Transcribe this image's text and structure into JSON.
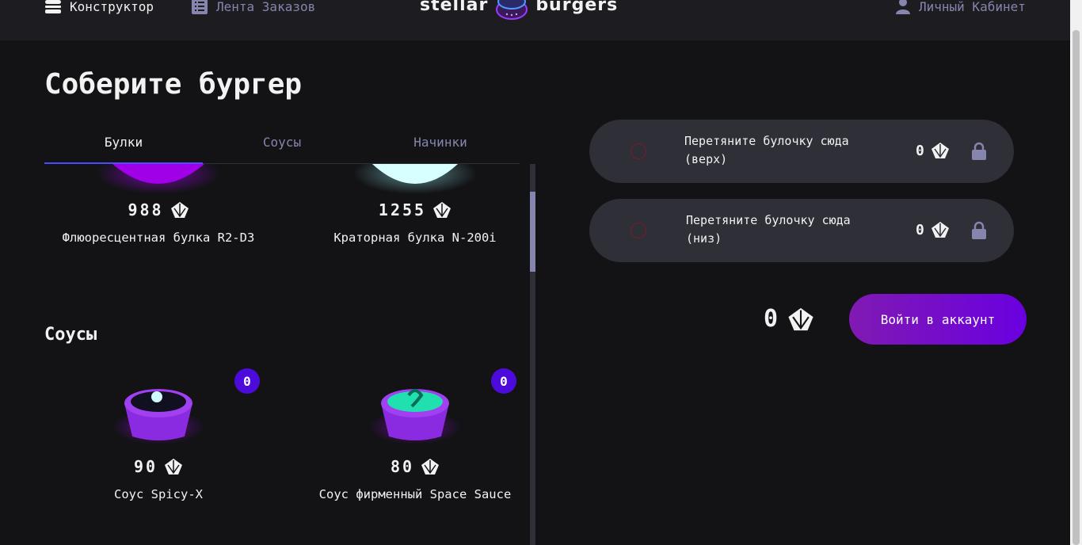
{
  "header": {
    "nav_constructor": "Конструктор",
    "nav_orders": "Лента Заказов",
    "logo_left": "stellar",
    "logo_right": "burgers",
    "nav_profile": "Личный Кабинет"
  },
  "main": {
    "title": "Соберите бургер",
    "tabs": [
      {
        "label": "Булки",
        "active": true
      },
      {
        "label": "Соусы",
        "active": false
      },
      {
        "label": "Начинки",
        "active": false
      }
    ],
    "buns": [
      {
        "price": "988",
        "name": "Флюоресцентная булка R2-D3",
        "color": "#b000ff"
      },
      {
        "price": "1255",
        "name": "Краторная булка N-200i",
        "color": "#d8ffff"
      }
    ],
    "sauces_title": "Соусы",
    "sauces": [
      {
        "price": "90",
        "name": "Соус Spicy-X",
        "count": "0"
      },
      {
        "price": "80",
        "name": "Соус фирменный Space Sauce",
        "count": "0"
      }
    ]
  },
  "constructor": {
    "top_slot": {
      "line1": "Перетяните булочку сюда",
      "line2": "(верх)",
      "price": "0"
    },
    "bottom_slot": {
      "line1": "Перетяните булочку сюда",
      "line2": "(низ)",
      "price": "0"
    },
    "total": "0",
    "login_button": "Войти в аккаунт"
  },
  "colors": {
    "accent": "#4c4cff",
    "counter": "#4c0bdb",
    "button": "#801ab2",
    "muted": "#8585ad"
  },
  "icons": [
    "burger-icon",
    "list-icon",
    "profile-icon",
    "currency-icon",
    "lock-icon"
  ]
}
